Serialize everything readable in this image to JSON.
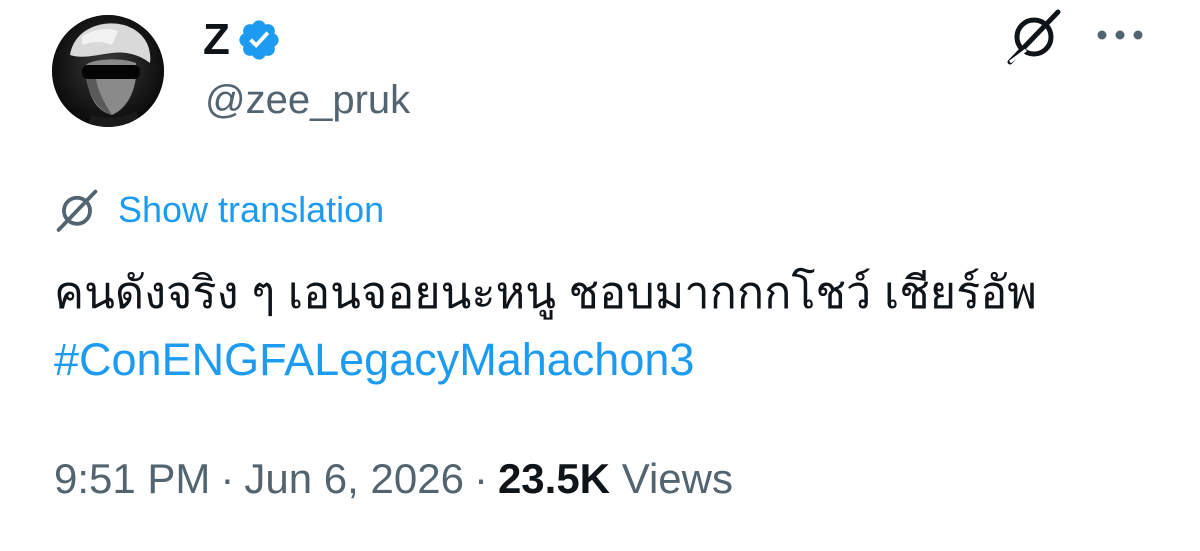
{
  "author": {
    "display_name": "Z",
    "handle": "@zee_pruk",
    "verified_color": "#1d9bf0"
  },
  "header_actions": {
    "grok_icon": "grok-icon",
    "more_icon": "more-horizontal-icon"
  },
  "translation": {
    "label": "Show translation",
    "icon": "grok-icon"
  },
  "tweet": {
    "text": "คนดังจริง ๆ เอนจอยนะหนู ชอบมากกกโชว์ เชียร์อัพ",
    "hashtag": "#ConENGFALegacyMahachon3"
  },
  "meta": {
    "time": "9:51 PM",
    "separator": "·",
    "date": "Jun 6, 2026",
    "views_count": "23.5K",
    "views_label": "Views"
  },
  "colors": {
    "accent": "#1d9bf0",
    "text_primary": "#0f1419",
    "text_secondary": "#536471"
  }
}
